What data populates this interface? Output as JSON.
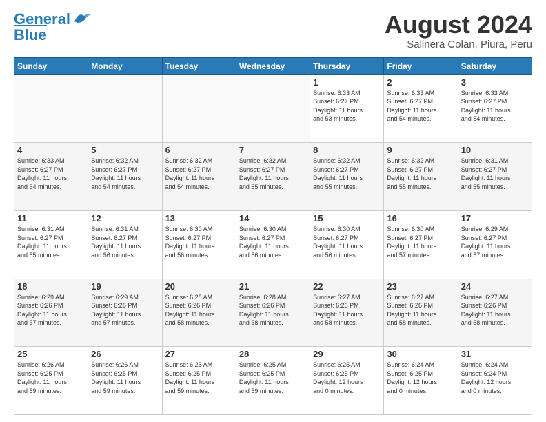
{
  "header": {
    "logo_line1": "General",
    "logo_line2": "Blue",
    "month_title": "August 2024",
    "subtitle": "Salinera Colan, Piura, Peru"
  },
  "days_of_week": [
    "Sunday",
    "Monday",
    "Tuesday",
    "Wednesday",
    "Thursday",
    "Friday",
    "Saturday"
  ],
  "weeks": [
    [
      {
        "day": "",
        "info": ""
      },
      {
        "day": "",
        "info": ""
      },
      {
        "day": "",
        "info": ""
      },
      {
        "day": "",
        "info": ""
      },
      {
        "day": "1",
        "info": "Sunrise: 6:33 AM\nSunset: 6:27 PM\nDaylight: 11 hours\nand 53 minutes."
      },
      {
        "day": "2",
        "info": "Sunrise: 6:33 AM\nSunset: 6:27 PM\nDaylight: 11 hours\nand 54 minutes."
      },
      {
        "day": "3",
        "info": "Sunrise: 6:33 AM\nSunset: 6:27 PM\nDaylight: 11 hours\nand 54 minutes."
      }
    ],
    [
      {
        "day": "4",
        "info": "Sunrise: 6:33 AM\nSunset: 6:27 PM\nDaylight: 11 hours\nand 54 minutes."
      },
      {
        "day": "5",
        "info": "Sunrise: 6:32 AM\nSunset: 6:27 PM\nDaylight: 11 hours\nand 54 minutes."
      },
      {
        "day": "6",
        "info": "Sunrise: 6:32 AM\nSunset: 6:27 PM\nDaylight: 11 hours\nand 54 minutes."
      },
      {
        "day": "7",
        "info": "Sunrise: 6:32 AM\nSunset: 6:27 PM\nDaylight: 11 hours\nand 55 minutes."
      },
      {
        "day": "8",
        "info": "Sunrise: 6:32 AM\nSunset: 6:27 PM\nDaylight: 11 hours\nand 55 minutes."
      },
      {
        "day": "9",
        "info": "Sunrise: 6:32 AM\nSunset: 6:27 PM\nDaylight: 11 hours\nand 55 minutes."
      },
      {
        "day": "10",
        "info": "Sunrise: 6:31 AM\nSunset: 6:27 PM\nDaylight: 11 hours\nand 55 minutes."
      }
    ],
    [
      {
        "day": "11",
        "info": "Sunrise: 6:31 AM\nSunset: 6:27 PM\nDaylight: 11 hours\nand 55 minutes."
      },
      {
        "day": "12",
        "info": "Sunrise: 6:31 AM\nSunset: 6:27 PM\nDaylight: 11 hours\nand 56 minutes."
      },
      {
        "day": "13",
        "info": "Sunrise: 6:30 AM\nSunset: 6:27 PM\nDaylight: 11 hours\nand 56 minutes."
      },
      {
        "day": "14",
        "info": "Sunrise: 6:30 AM\nSunset: 6:27 PM\nDaylight: 11 hours\nand 56 minutes."
      },
      {
        "day": "15",
        "info": "Sunrise: 6:30 AM\nSunset: 6:27 PM\nDaylight: 11 hours\nand 56 minutes."
      },
      {
        "day": "16",
        "info": "Sunrise: 6:30 AM\nSunset: 6:27 PM\nDaylight: 11 hours\nand 57 minutes."
      },
      {
        "day": "17",
        "info": "Sunrise: 6:29 AM\nSunset: 6:27 PM\nDaylight: 11 hours\nand 57 minutes."
      }
    ],
    [
      {
        "day": "18",
        "info": "Sunrise: 6:29 AM\nSunset: 6:26 PM\nDaylight: 11 hours\nand 57 minutes."
      },
      {
        "day": "19",
        "info": "Sunrise: 6:29 AM\nSunset: 6:26 PM\nDaylight: 11 hours\nand 57 minutes."
      },
      {
        "day": "20",
        "info": "Sunrise: 6:28 AM\nSunset: 6:26 PM\nDaylight: 11 hours\nand 58 minutes."
      },
      {
        "day": "21",
        "info": "Sunrise: 6:28 AM\nSunset: 6:26 PM\nDaylight: 11 hours\nand 58 minutes."
      },
      {
        "day": "22",
        "info": "Sunrise: 6:27 AM\nSunset: 6:26 PM\nDaylight: 11 hours\nand 58 minutes."
      },
      {
        "day": "23",
        "info": "Sunrise: 6:27 AM\nSunset: 6:26 PM\nDaylight: 11 hours\nand 58 minutes."
      },
      {
        "day": "24",
        "info": "Sunrise: 6:27 AM\nSunset: 6:26 PM\nDaylight: 11 hours\nand 58 minutes."
      }
    ],
    [
      {
        "day": "25",
        "info": "Sunrise: 6:26 AM\nSunset: 6:25 PM\nDaylight: 11 hours\nand 59 minutes."
      },
      {
        "day": "26",
        "info": "Sunrise: 6:26 AM\nSunset: 6:25 PM\nDaylight: 11 hours\nand 59 minutes."
      },
      {
        "day": "27",
        "info": "Sunrise: 6:25 AM\nSunset: 6:25 PM\nDaylight: 11 hours\nand 59 minutes."
      },
      {
        "day": "28",
        "info": "Sunrise: 6:25 AM\nSunset: 6:25 PM\nDaylight: 11 hours\nand 59 minutes."
      },
      {
        "day": "29",
        "info": "Sunrise: 6:25 AM\nSunset: 6:25 PM\nDaylight: 12 hours\nand 0 minutes."
      },
      {
        "day": "30",
        "info": "Sunrise: 6:24 AM\nSunset: 6:25 PM\nDaylight: 12 hours\nand 0 minutes."
      },
      {
        "day": "31",
        "info": "Sunrise: 6:24 AM\nSunset: 6:24 PM\nDaylight: 12 hours\nand 0 minutes."
      }
    ]
  ]
}
